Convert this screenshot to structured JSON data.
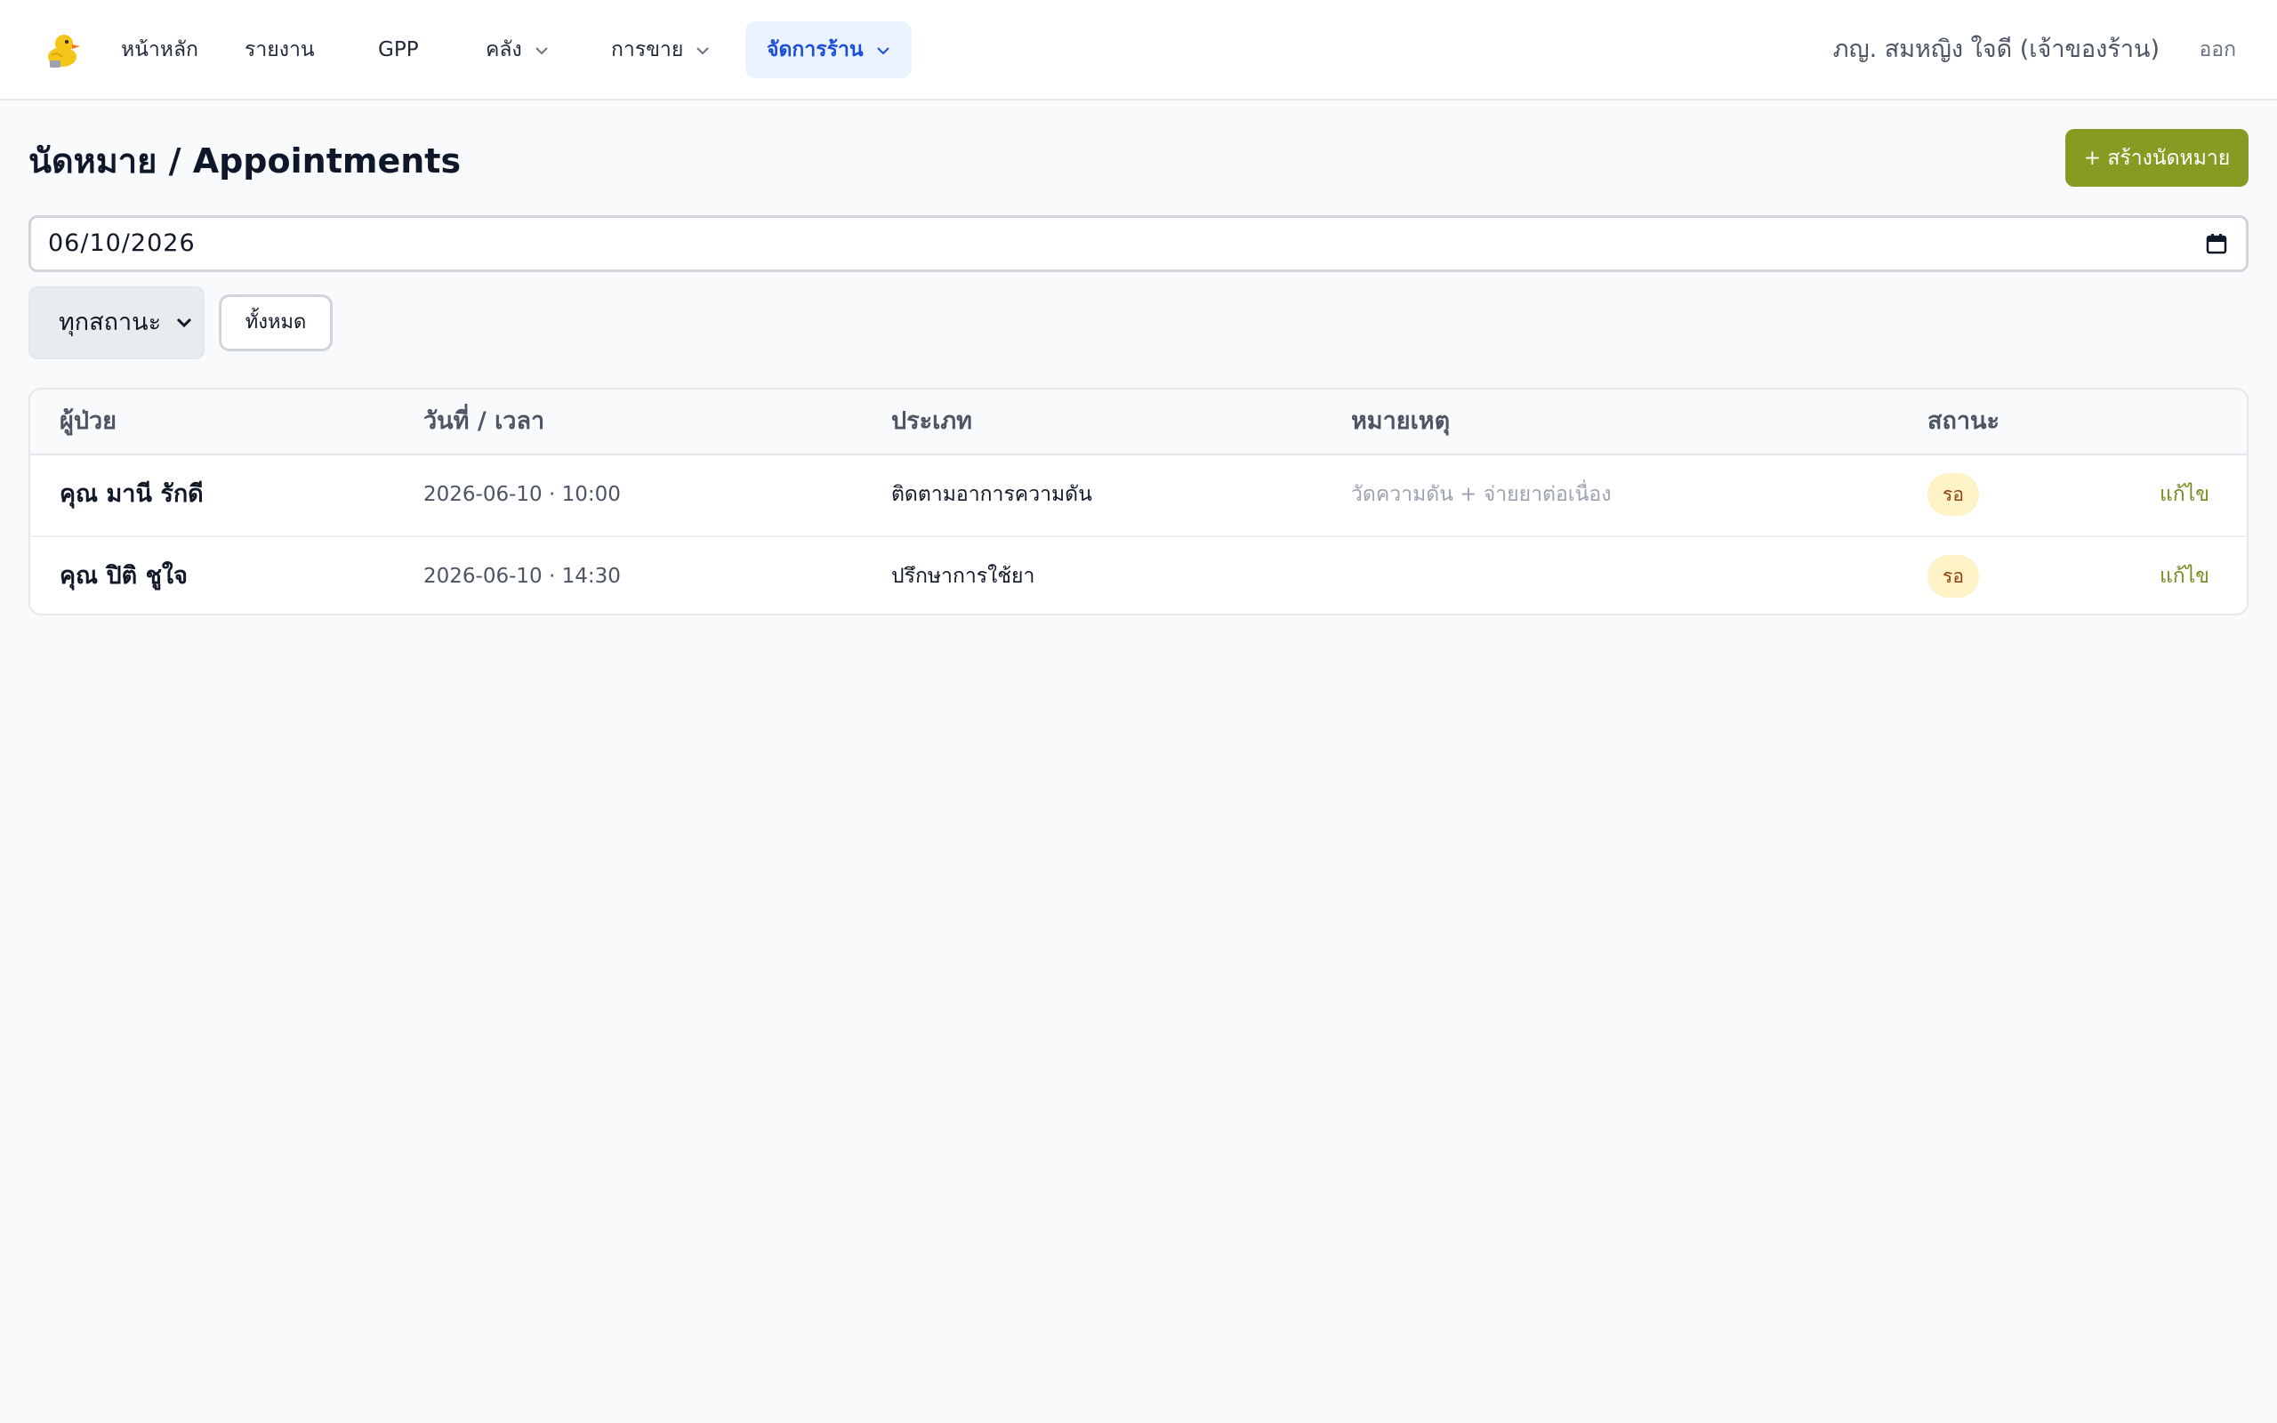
{
  "nav": {
    "items": [
      {
        "label": "หน้าหลัก"
      },
      {
        "label": "รายงาน"
      },
      {
        "label": "GPP"
      },
      {
        "label": "คลัง"
      },
      {
        "label": "การขาย"
      },
      {
        "label": "จัดการร้าน"
      }
    ],
    "user_name": "ภญ. สมหญิง ใจดี (เจ้าของร้าน)",
    "logout_label": "ออก"
  },
  "page": {
    "title": "นัดหมาย / Appointments",
    "create_label": "+ สร้างนัดหมาย"
  },
  "filters": {
    "date_value": "06/10/2026",
    "status_selected": "ทุกสถานะ",
    "all_label": "ทั้งหมด"
  },
  "table": {
    "headers": {
      "patient": "ผู้ป่วย",
      "datetime": "วันที่ / เวลา",
      "type": "ประเภท",
      "note": "หมายเหตุ",
      "status": "สถานะ"
    },
    "rows": [
      {
        "patient": "คุณ มานี รักดี",
        "datetime": "2026-06-10 · 10:00",
        "type": "ติดตามอาการความดัน",
        "note": "วัดความดัน + จ่ายยาต่อเนื่อง",
        "status": "รอ",
        "action": "แก้ไข"
      },
      {
        "patient": "คุณ ปิติ ชูใจ",
        "datetime": "2026-06-10 · 14:30",
        "type": "ปรึกษาการใช้ยา",
        "note": "",
        "status": "รอ",
        "action": "แก้ไข"
      }
    ]
  },
  "colors": {
    "accent": "#879b23",
    "active_nav_bg": "#eaf3ff",
    "active_nav_text": "#1d4ed8",
    "badge_bg": "#fef3c7",
    "badge_text": "#92400e"
  }
}
